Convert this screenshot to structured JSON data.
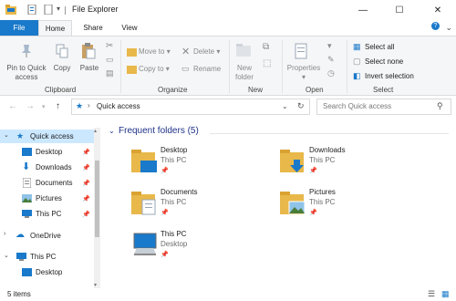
{
  "window": {
    "title": "File Explorer",
    "controls": {
      "minimize": "—",
      "maximize": "☐",
      "close": "✕"
    }
  },
  "ribbon_tabs": [
    "File",
    "Home",
    "Share",
    "View"
  ],
  "ribbon": {
    "clipboard": {
      "pin_to_quick_access": "Pin to Quick",
      "pin_to_quick_access_2": "access",
      "copy": "Copy",
      "paste": "Paste",
      "group_label": "Clipboard"
    },
    "organize": {
      "move_to": "Move to",
      "copy_to": "Copy to",
      "delete": "Delete",
      "rename": "Rename",
      "group_label": "Organize"
    },
    "new": {
      "new_folder": "New",
      "new_folder_2": "folder",
      "group_label": "New"
    },
    "open": {
      "properties": "Properties",
      "group_label": "Open"
    },
    "select": {
      "select_all": "Select all",
      "select_none": "Select none",
      "invert_selection": "Invert selection",
      "group_label": "Select"
    }
  },
  "address": {
    "path": "Quick access",
    "search_placeholder": "Search Quick access"
  },
  "nav_pane": {
    "items": [
      {
        "label": "Quick access",
        "pinned": false
      },
      {
        "label": "Desktop",
        "pinned": true
      },
      {
        "label": "Downloads",
        "pinned": true
      },
      {
        "label": "Documents",
        "pinned": true
      },
      {
        "label": "Pictures",
        "pinned": true
      },
      {
        "label": "This PC",
        "pinned": true
      },
      {
        "label": "OneDrive",
        "pinned": false
      },
      {
        "label": "This PC",
        "pinned": false
      },
      {
        "label": "Desktop",
        "pinned": false
      }
    ]
  },
  "content": {
    "section_title": "Frequent folders (5)",
    "folders": [
      {
        "name": "Desktop",
        "location": "This PC"
      },
      {
        "name": "Downloads",
        "location": "This PC"
      },
      {
        "name": "Documents",
        "location": "This PC"
      },
      {
        "name": "Pictures",
        "location": "This PC"
      },
      {
        "name": "This PC",
        "location": "Desktop"
      }
    ]
  },
  "status": {
    "item_count": "5 items"
  },
  "colors": {
    "accent": "#1979ca",
    "folder": "#e8b84a",
    "selected": "#cce8ff",
    "section_title": "#1e3287"
  }
}
